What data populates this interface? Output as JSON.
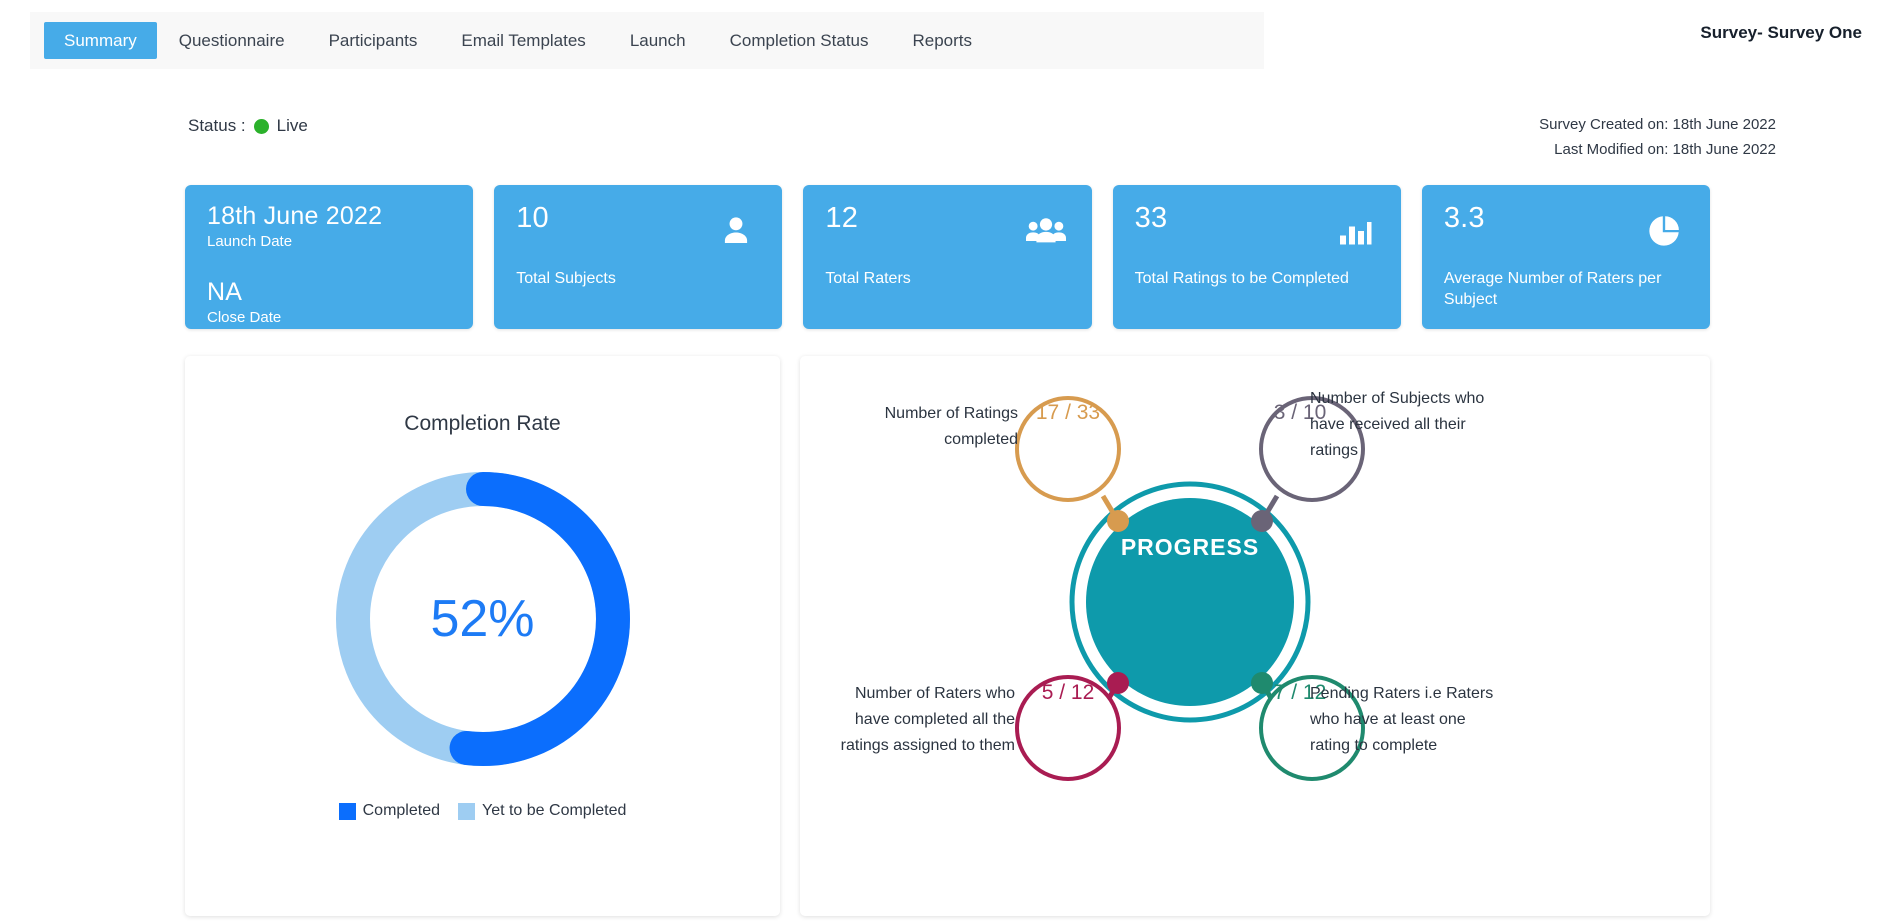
{
  "header": {
    "survey_title": "Survey- Survey One",
    "tabs": [
      {
        "label": "Summary",
        "active": true
      },
      {
        "label": "Questionnaire",
        "active": false
      },
      {
        "label": "Participants",
        "active": false
      },
      {
        "label": "Email Templates",
        "active": false
      },
      {
        "label": "Launch",
        "active": false
      },
      {
        "label": "Completion Status",
        "active": false
      },
      {
        "label": "Reports",
        "active": false
      }
    ]
  },
  "status": {
    "label": "Status :",
    "value": "Live",
    "dot_color": "#2bb12b"
  },
  "meta": {
    "created": "Survey Created on: 18th June 2022",
    "modified": "Last Modified on: 18th June 2022"
  },
  "cards": [
    {
      "type": "dates",
      "launch_date": "18th June 2022",
      "launch_label": "Launch Date",
      "close_date": "NA",
      "close_label": "Close Date",
      "icon": ""
    },
    {
      "type": "stat",
      "value": "10",
      "label": "Total Subjects",
      "icon": "person-icon"
    },
    {
      "type": "stat",
      "value": "12",
      "label": "Total Raters",
      "icon": "people-group-icon"
    },
    {
      "type": "stat",
      "value": "33",
      "label": "Total Ratings to be Completed",
      "icon": "bar-chart-icon"
    },
    {
      "type": "stat",
      "value": "3.3",
      "label": "Average Number of Raters per Subject",
      "icon": "pie-chart-icon"
    }
  ],
  "completion_panel": {
    "title": "Completion Rate",
    "center_value": "52%",
    "legend": [
      {
        "label": "Completed",
        "color": "#0b6efd"
      },
      {
        "label": "Yet to be Completed",
        "color": "#9ecdf2"
      }
    ]
  },
  "progress_panel": {
    "center_label": "PROGRESS",
    "center_color": "#0e9aab",
    "nodes": [
      {
        "id": "ratings",
        "value": "17 / 33",
        "label": "Number of Ratings completed",
        "color": "#d79b4f"
      },
      {
        "id": "subjects",
        "value": "3 / 10",
        "label": "Number of Subjects who have received all their ratings",
        "color": "#6a6477"
      },
      {
        "id": "raters",
        "value": "5 / 12",
        "label": "Number of Raters who have completed all the ratings assigned to them",
        "color": "#a91c52"
      },
      {
        "id": "pending",
        "value": "7 / 12",
        "label": "Pending Raters i.e Raters who have at least one rating to complete",
        "color": "#1f8a6e"
      }
    ]
  },
  "chart_data": {
    "type": "pie",
    "title": "Completion Rate",
    "labels": [
      "Completed",
      "Yet to be Completed"
    ],
    "values": [
      52,
      48
    ],
    "colors": [
      "#0b6efd",
      "#9ecdf2"
    ],
    "center_text": "52%",
    "legend_position": "bottom",
    "donut": true
  }
}
